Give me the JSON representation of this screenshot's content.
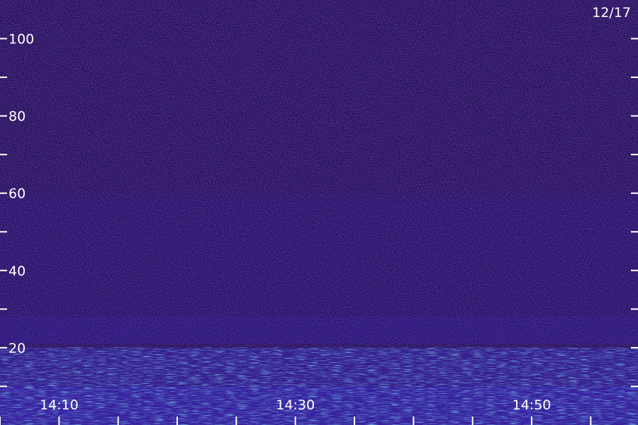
{
  "chart_data": {
    "type": "heatmap",
    "title": "",
    "date_label": "12/17",
    "xlabel": "",
    "ylabel": "",
    "x_ticks_labeled": [
      "14:10",
      "14:30",
      "14:50"
    ],
    "x_tick_step_minutes": 5,
    "xlim": [
      "14:05",
      "14:59"
    ],
    "y_ticks_labeled": [
      20,
      40,
      60,
      80,
      100
    ],
    "y_tick_step": 10,
    "ylim": [
      0,
      110
    ],
    "grid": false,
    "legend": "none",
    "colormap": [
      "#1a0a4a",
      "#2a1090",
      "#3a28d8",
      "#30a0ff",
      "#40ffd0",
      "#a0ff60"
    ],
    "intensity_bands": [
      {
        "y_from": 0,
        "y_to": 10,
        "level": 0.85
      },
      {
        "y_from": 10,
        "y_to": 20,
        "level": 0.6
      },
      {
        "y_from": 21,
        "y_to": 28,
        "level": 0.4
      },
      {
        "y_from": 28,
        "y_to": 60,
        "level": 0.15
      }
    ]
  }
}
